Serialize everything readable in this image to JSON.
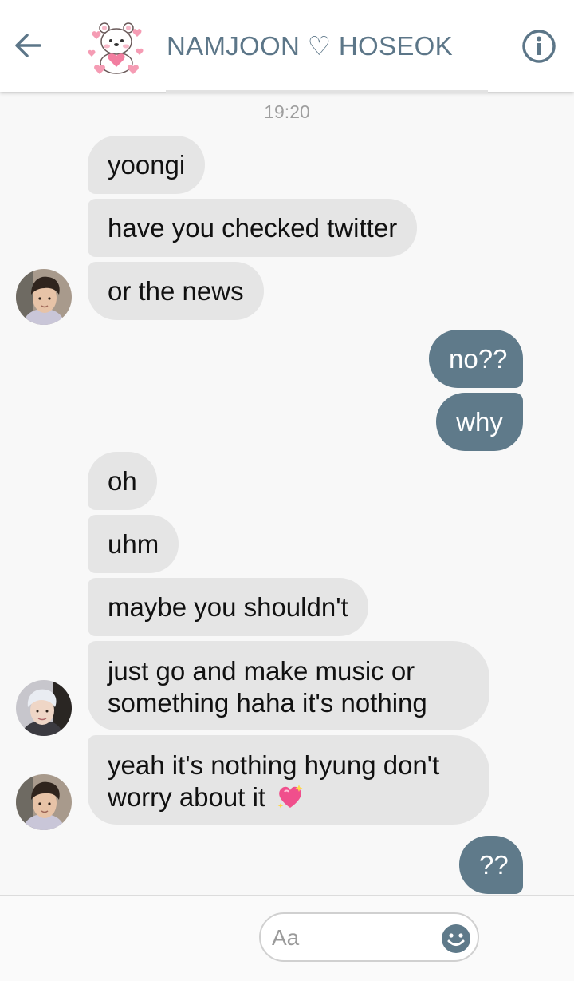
{
  "header": {
    "title": "NAMJOON ♡ HOSEOK",
    "back_icon": "arrow-left-icon",
    "info_icon": "info-icon",
    "group_avatar": "bear-with-hearts-sticker"
  },
  "conversation": {
    "timestamp": "19:20",
    "messages": [
      {
        "side": "incoming",
        "text": "yoongi"
      },
      {
        "side": "incoming",
        "text": "have you checked twitter"
      },
      {
        "side": "incoming",
        "text": "or the news"
      },
      {
        "side": "outgoing",
        "text": "no??"
      },
      {
        "side": "outgoing",
        "text": "why"
      },
      {
        "side": "incoming",
        "text": "oh"
      },
      {
        "side": "incoming",
        "text": "uhm"
      },
      {
        "side": "incoming",
        "text": "maybe you shouldn't"
      },
      {
        "side": "incoming",
        "lines": [
          "just go and make music or",
          "something haha it's nothing"
        ]
      },
      {
        "side": "incoming",
        "lines": [
          "yeah it's nothing hyung don't",
          "worry about it"
        ],
        "emoji": "sparkling-heart-icon"
      },
      {
        "side": "outgoing",
        "text": "??"
      }
    ]
  },
  "composer": {
    "placeholder": "Aa",
    "icons": [
      "more-icon",
      "camera-icon",
      "image-icon",
      "microphone-icon",
      "smiley-icon",
      "thumbs-up-icon"
    ]
  },
  "colors": {
    "accent": "#5f7a8a",
    "incoming_bubble": "#e5e5e5",
    "header_text": "#5c7688",
    "background": "#f8f8f8"
  }
}
